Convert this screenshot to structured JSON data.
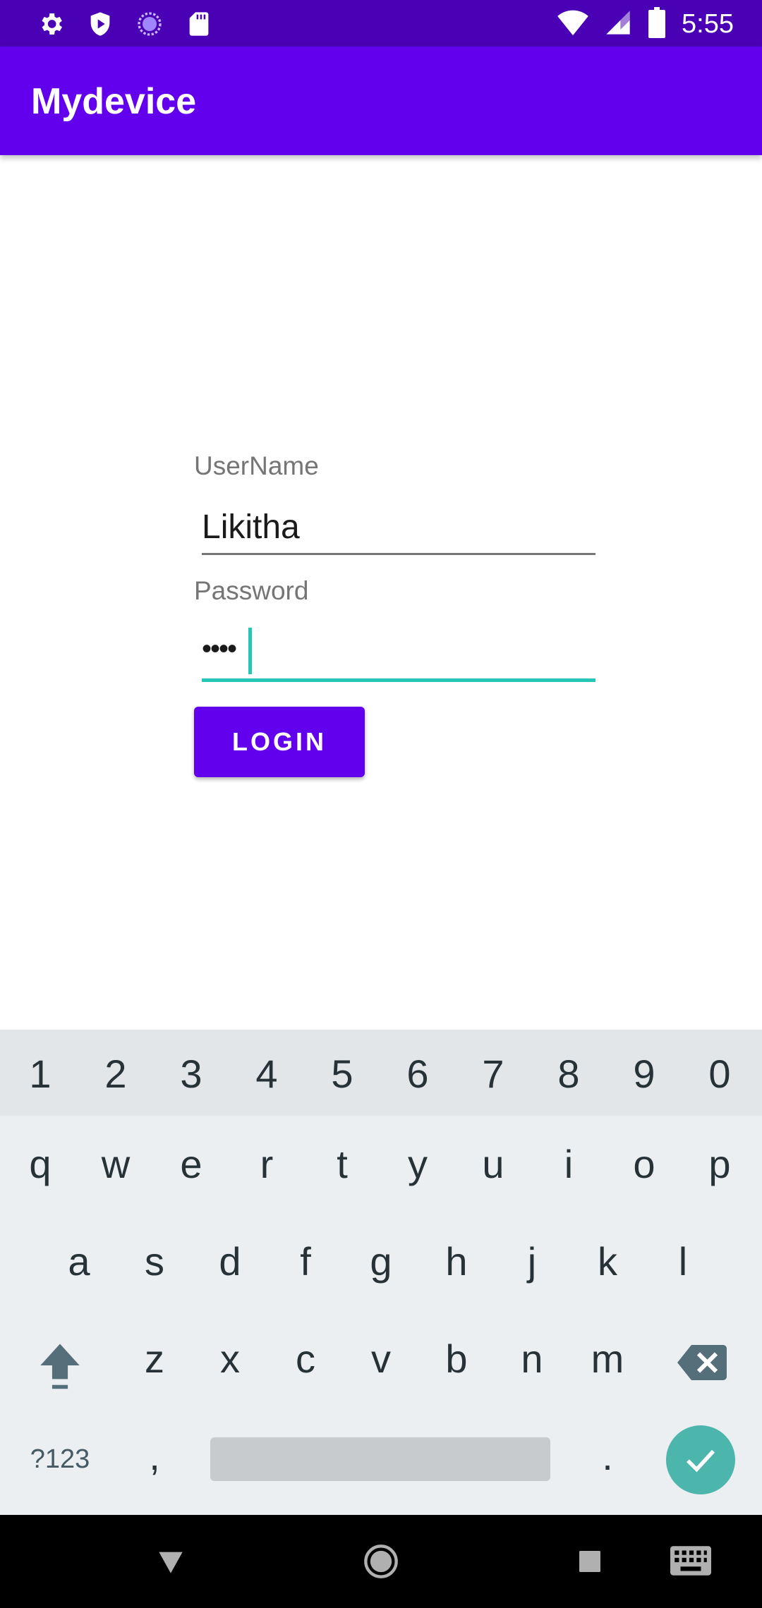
{
  "status_bar": {
    "time": "5:55",
    "left_icons": [
      "settings-icon",
      "shield-play-icon",
      "sync-circle-icon",
      "sd-card-icon"
    ],
    "right_icons": [
      "wifi-icon",
      "signal-icon",
      "battery-icon"
    ]
  },
  "app_bar": {
    "title": "Mydevice"
  },
  "form": {
    "username_label": "UserName",
    "username_value": "Likitha",
    "password_label": "Password",
    "password_value": "••••",
    "login_label": "LOGIN"
  },
  "keyboard": {
    "numbers": [
      "1",
      "2",
      "3",
      "4",
      "5",
      "6",
      "7",
      "8",
      "9",
      "0"
    ],
    "row1": [
      "q",
      "w",
      "e",
      "r",
      "t",
      "y",
      "u",
      "i",
      "o",
      "p"
    ],
    "row2": [
      "a",
      "s",
      "d",
      "f",
      "g",
      "h",
      "j",
      "k",
      "l"
    ],
    "row3": [
      "z",
      "x",
      "c",
      "v",
      "b",
      "n",
      "m"
    ],
    "symbols_label": "?123",
    "comma": ",",
    "period": "."
  },
  "nav_bar": {
    "icons": [
      "back-icon",
      "home-icon",
      "recents-icon",
      "keyboard-switch-icon"
    ]
  },
  "colors": {
    "status_bar": "#4a00b4",
    "app_bar": "#6200ee",
    "accent": "#26c6b7",
    "enter": "#4db6ac"
  }
}
